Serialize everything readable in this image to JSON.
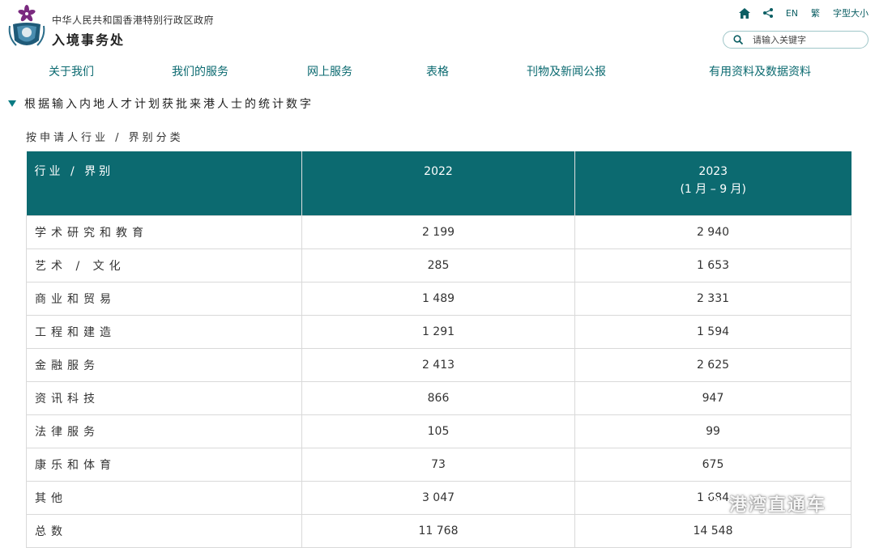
{
  "header": {
    "gov_name": "中华人民共和国香港特别行政区政府",
    "dept_name": "入境事务处",
    "tools": {
      "lang_en": "EN",
      "lang_trad": "繁",
      "font_size": "字型大小"
    },
    "search": {
      "placeholder": "请输入关键字"
    }
  },
  "nav": [
    "关于我们",
    "我们的服务",
    "网上服务",
    "表格",
    "刊物及新闻公报",
    "有用资料及数据资料"
  ],
  "section_title": "根据输入内地人才计划获批来港人士的统计数字",
  "subtitle": "按申请人行业 / 界别分类",
  "table": {
    "headers": {
      "category": "行业 / 界别",
      "col1": "2022",
      "col2_line1": "2023",
      "col2_line2": "(1 月 – 9 月)"
    },
    "rows": [
      {
        "category": "学术研究和教育",
        "y2022": "2 199",
        "y2023": "2 940"
      },
      {
        "category": "艺术 / 文化",
        "y2022": "285",
        "y2023": "1 653"
      },
      {
        "category": "商业和贸易",
        "y2022": "1 489",
        "y2023": "2 331"
      },
      {
        "category": "工程和建造",
        "y2022": "1 291",
        "y2023": "1 594"
      },
      {
        "category": "金融服务",
        "y2022": "2 413",
        "y2023": "2 625"
      },
      {
        "category": "资讯科技",
        "y2022": "866",
        "y2023": "947"
      },
      {
        "category": "法律服务",
        "y2022": "105",
        "y2023": "99"
      },
      {
        "category": "康乐和体育",
        "y2022": "73",
        "y2023": "675"
      },
      {
        "category": "其他",
        "y2022": "3 047",
        "y2023": "1 684"
      },
      {
        "category": "总数",
        "y2022": "11 768",
        "y2023": "14 548"
      }
    ]
  },
  "watermark": "港湾直通车",
  "colors": {
    "primary": "#0c6a70",
    "nav_text": "#0b6a70",
    "emblem": "#7a2a7f"
  }
}
